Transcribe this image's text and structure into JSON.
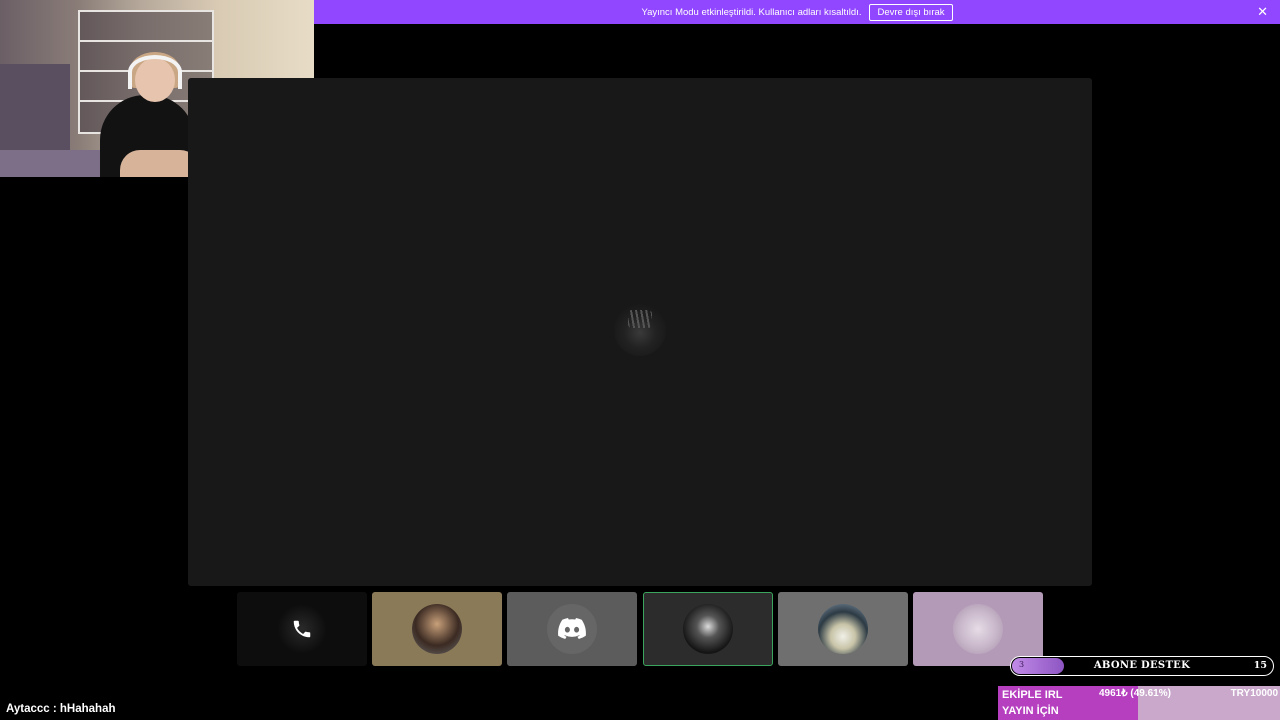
{
  "banner": {
    "message": "Yayıncı Modu etkinleştirildi. Kullanıcı adları kısaltıldı.",
    "disable_label": "Devre dışı bırak",
    "close_icon": "close-icon",
    "color": "#9146ff"
  },
  "webcam": {
    "description_icon": "webcam-feed"
  },
  "stage": {
    "focused_avatar": "speaker-avatar"
  },
  "participants": [
    {
      "icon": "phone-icon"
    },
    {
      "icon": "avatar"
    },
    {
      "icon": "discord-logo-icon"
    },
    {
      "icon": "avatar",
      "speaking": true
    },
    {
      "icon": "avatar"
    },
    {
      "icon": "avatar"
    }
  ],
  "chat": {
    "line": "Aytaccc : hHahahah"
  },
  "sub_goal": {
    "current": "3",
    "title": "ABONE DESTEK",
    "target": "15",
    "progress_fraction": 0.2
  },
  "donation_goal": {
    "label_line1": "EKİPLE IRL",
    "label_line2": "YAYIN İÇİN",
    "amount": "4961₺ (49.61%)",
    "goal": "TRY10000",
    "progress_fraction": 0.4961,
    "fill_color": "#b53fbf"
  }
}
